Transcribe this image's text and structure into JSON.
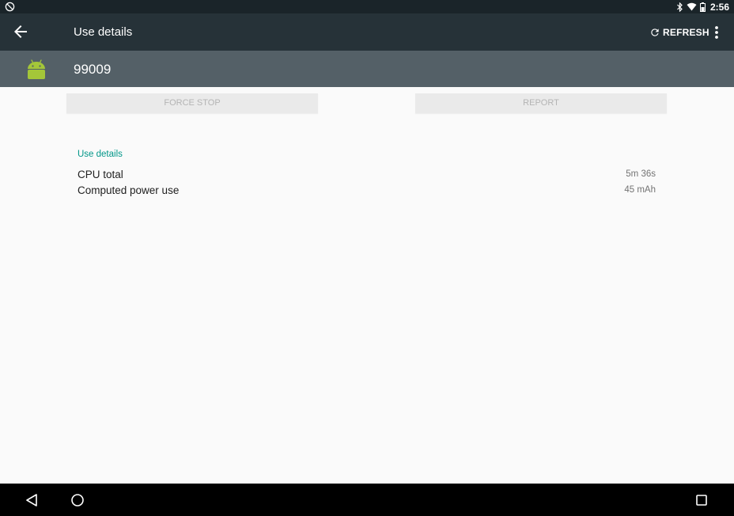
{
  "status_bar": {
    "time": "2:56",
    "icons": [
      "no-sim-icon",
      "bluetooth-icon",
      "wifi-icon",
      "battery-icon"
    ]
  },
  "app_bar": {
    "title": "Use details",
    "refresh_label": "REFRESH",
    "icons": [
      "back-arrow-icon",
      "refresh-icon",
      "overflow-menu-icon"
    ]
  },
  "app_header": {
    "app_name": "99009",
    "icon": "android-icon"
  },
  "buttons": {
    "force_stop": "FORCE STOP",
    "report": "REPORT"
  },
  "section": {
    "title": "Use details",
    "rows": [
      {
        "label": "CPU total",
        "value": "5m 36s"
      },
      {
        "label": "Computed power use",
        "value": "45 mAh"
      }
    ]
  },
  "colors": {
    "status_bar": "#1a2429",
    "app_bar": "#263238",
    "app_header": "#546067",
    "accent": "#009688",
    "android_green": "#a4c639",
    "background": "#fafafa"
  },
  "nav_bar": {
    "icons": [
      "nav-back-icon",
      "nav-home-icon",
      "nav-recents-icon"
    ]
  }
}
